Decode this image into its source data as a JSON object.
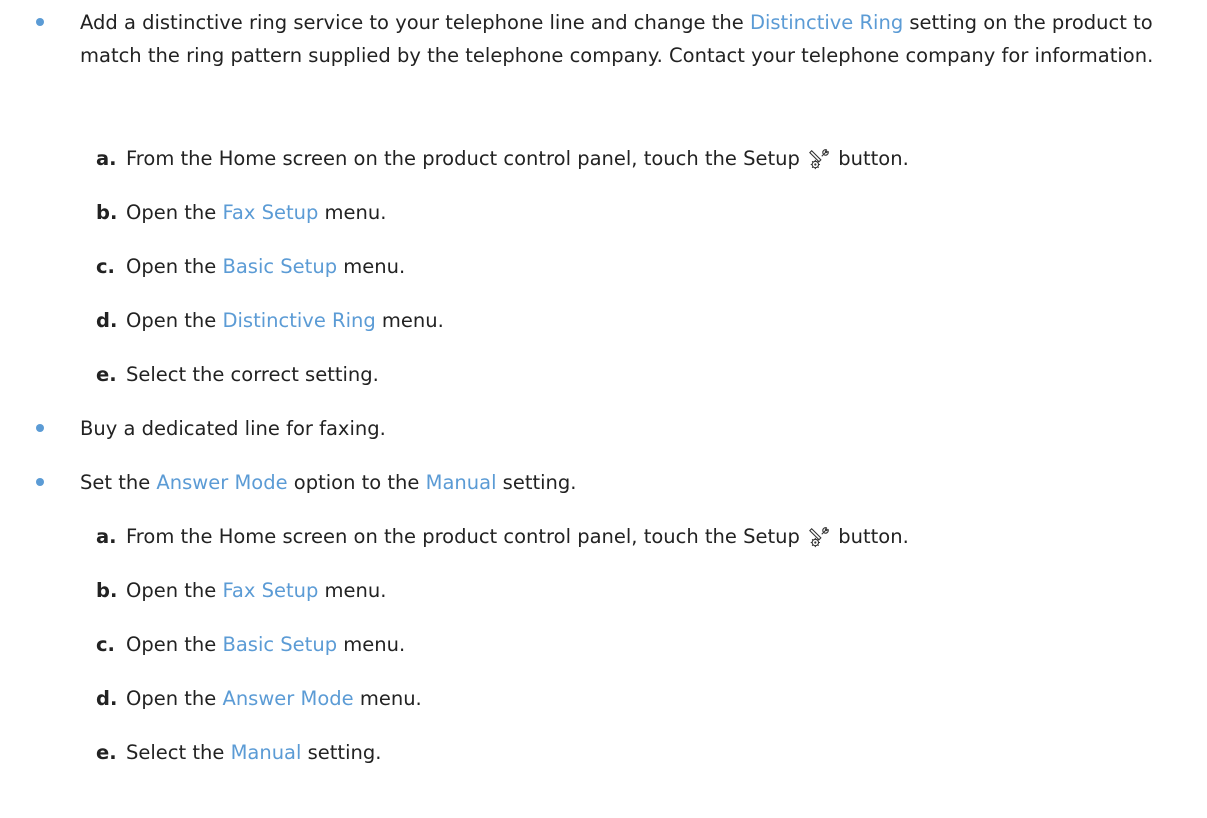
{
  "colors": {
    "accent": "#5b9bd5",
    "text": "#222222"
  },
  "bullets": [
    {
      "parts": [
        {
          "text": "Add a distinctive ring service to your telephone line and change the "
        },
        {
          "text": "Distinctive Ring",
          "link": true
        },
        {
          "text": " setting on the product to match the ring pattern supplied by the telephone company. Contact your telephone company for information."
        }
      ],
      "steps": [
        {
          "letter": "a.",
          "parts": [
            {
              "text": "From the Home screen on the product control panel, touch the Setup "
            },
            {
              "icon": "setup-icon"
            },
            {
              "text": " button."
            }
          ]
        },
        {
          "letter": "b.",
          "parts": [
            {
              "text": "Open the "
            },
            {
              "text": "Fax Setup",
              "link": true
            },
            {
              "text": " menu."
            }
          ]
        },
        {
          "letter": "c.",
          "parts": [
            {
              "text": "Open the "
            },
            {
              "text": "Basic Setup",
              "link": true
            },
            {
              "text": " menu."
            }
          ]
        },
        {
          "letter": "d.",
          "parts": [
            {
              "text": "Open the "
            },
            {
              "text": "Distinctive Ring",
              "link": true
            },
            {
              "text": " menu."
            }
          ]
        },
        {
          "letter": "e.",
          "parts": [
            {
              "text": "Select the correct setting."
            }
          ]
        }
      ]
    },
    {
      "parts": [
        {
          "text": "Buy a dedicated line for faxing."
        }
      ],
      "steps": []
    },
    {
      "parts": [
        {
          "text": "Set the "
        },
        {
          "text": "Answer Mode",
          "link": true
        },
        {
          "text": " option to the "
        },
        {
          "text": "Manual",
          "link": true
        },
        {
          "text": " setting."
        }
      ],
      "steps": [
        {
          "letter": "a.",
          "parts": [
            {
              "text": "From the Home screen on the product control panel, touch the Setup "
            },
            {
              "icon": "setup-icon"
            },
            {
              "text": " button."
            }
          ]
        },
        {
          "letter": "b.",
          "parts": [
            {
              "text": "Open the "
            },
            {
              "text": "Fax Setup",
              "link": true
            },
            {
              "text": " menu."
            }
          ]
        },
        {
          "letter": "c.",
          "parts": [
            {
              "text": "Open the "
            },
            {
              "text": "Basic Setup",
              "link": true
            },
            {
              "text": " menu."
            }
          ]
        },
        {
          "letter": "d.",
          "parts": [
            {
              "text": "Open the "
            },
            {
              "text": "Answer Mode",
              "link": true
            },
            {
              "text": " menu."
            }
          ]
        },
        {
          "letter": "e.",
          "parts": [
            {
              "text": "Select the "
            },
            {
              "text": "Manual",
              "link": true
            },
            {
              "text": " setting."
            }
          ]
        }
      ]
    }
  ]
}
